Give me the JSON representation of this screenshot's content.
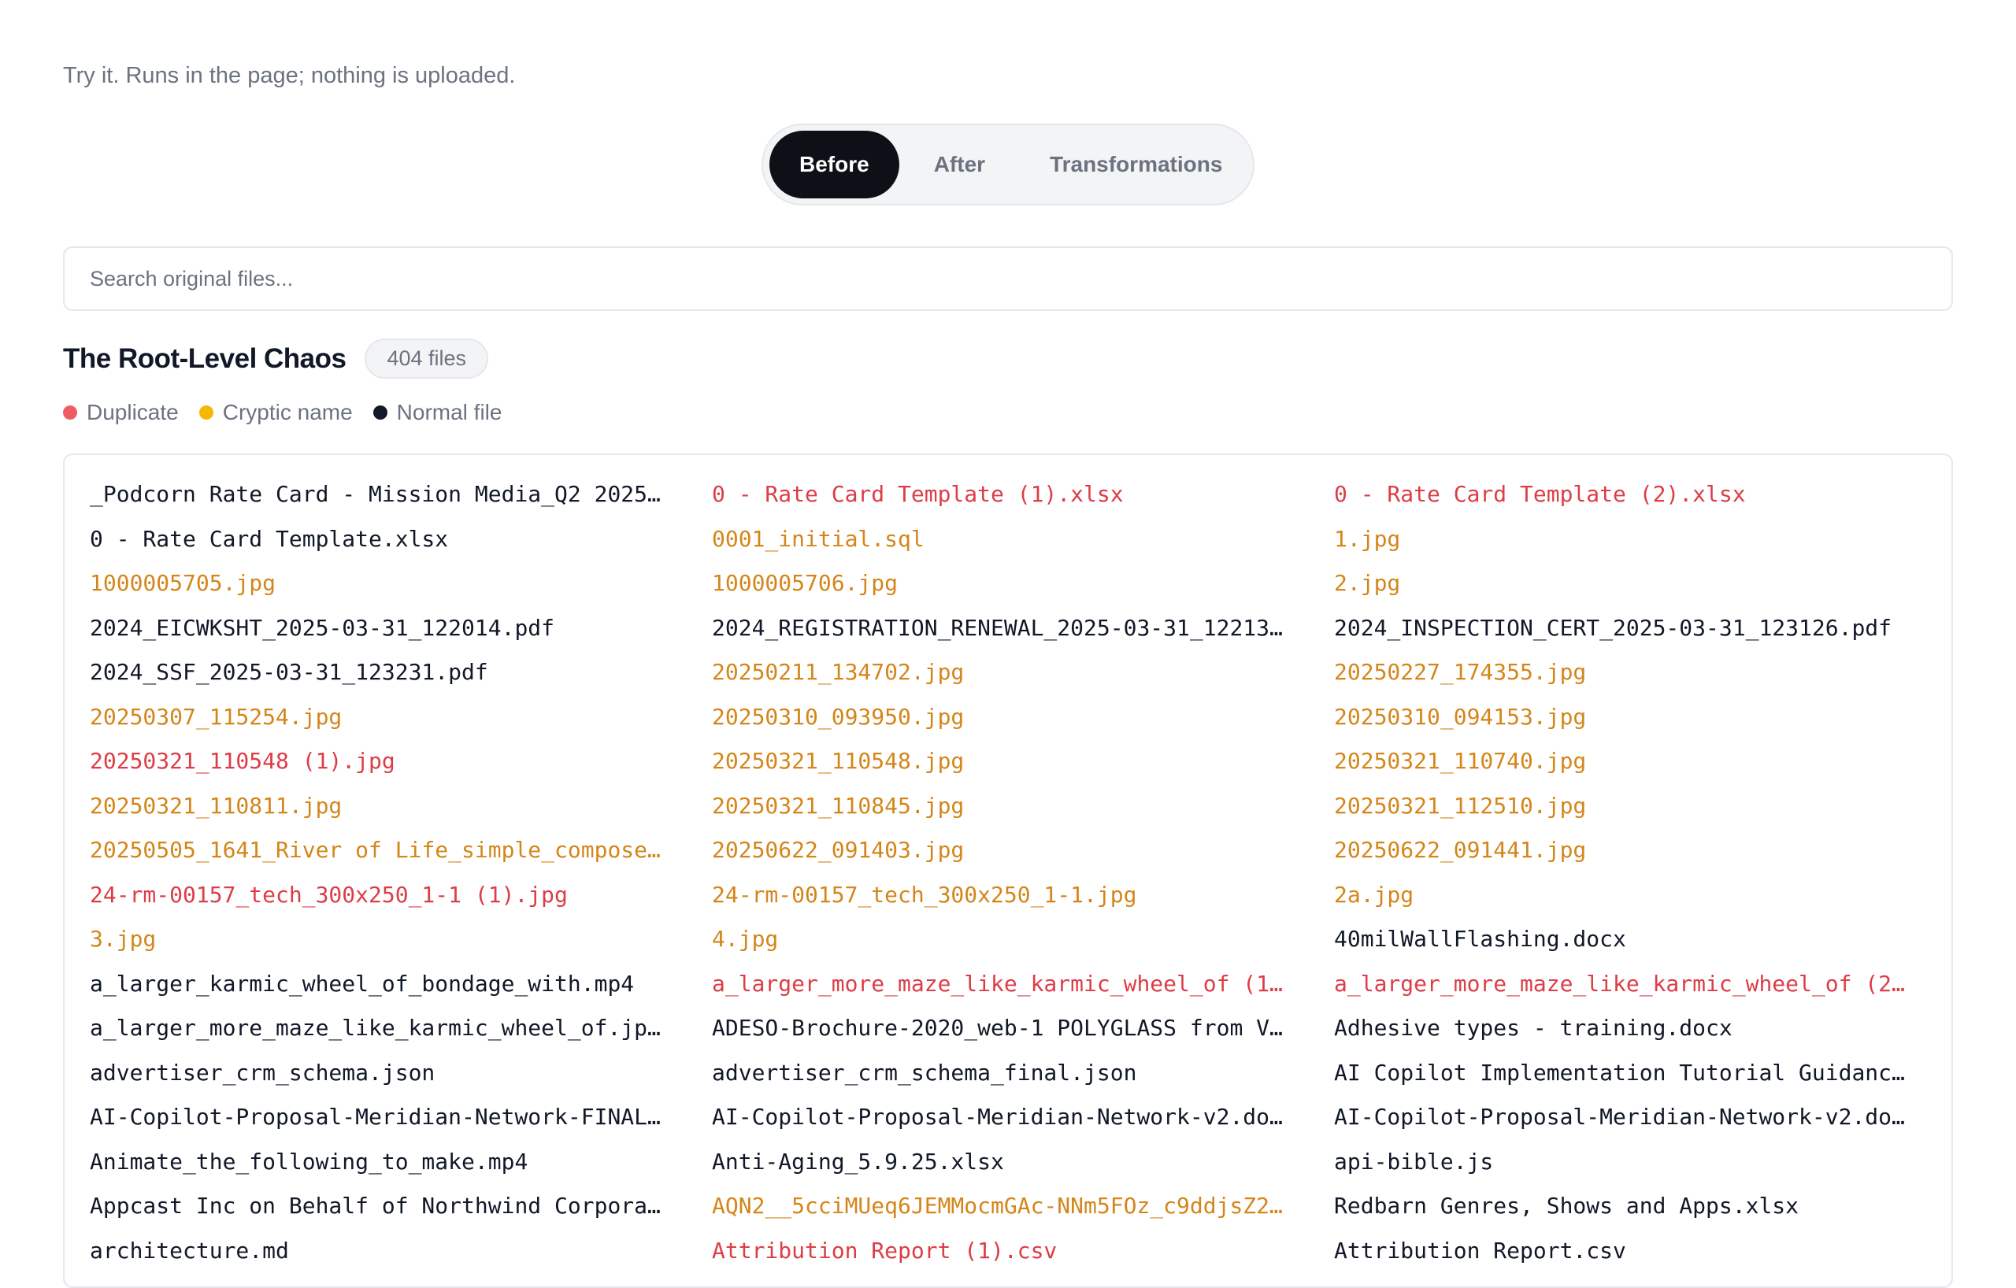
{
  "intro_text": "Try it. Runs in the page; nothing is uploaded.",
  "tabs": [
    {
      "label": "Before",
      "active": true
    },
    {
      "label": "After",
      "active": false
    },
    {
      "label": "Transformations",
      "active": false
    }
  ],
  "search": {
    "placeholder": "Search original files...",
    "value": ""
  },
  "section": {
    "title": "The Root-Level Chaos",
    "count_label": "404 files"
  },
  "legend": [
    {
      "label": "Duplicate",
      "color": "#ef5b63"
    },
    {
      "label": "Cryptic name",
      "color": "#f5b800"
    },
    {
      "label": "Normal file",
      "color": "#111827"
    }
  ],
  "colors": {
    "duplicate": "#dc3d47",
    "cryptic": "#d4861a",
    "normal": "#111827",
    "active_tab": "#0d1117"
  },
  "files": [
    {
      "name": "_Podcorn Rate Card - Mission Media_Q2 2025_…",
      "kind": "normal"
    },
    {
      "name": "0 - Rate Card Template (1).xlsx",
      "kind": "dup"
    },
    {
      "name": "0 - Rate Card Template (2).xlsx",
      "kind": "dup"
    },
    {
      "name": "0 - Rate Card Template.xlsx",
      "kind": "normal"
    },
    {
      "name": "0001_initial.sql",
      "kind": "cryptic"
    },
    {
      "name": "1.jpg",
      "kind": "cryptic"
    },
    {
      "name": "1000005705.jpg",
      "kind": "cryptic"
    },
    {
      "name": "1000005706.jpg",
      "kind": "cryptic"
    },
    {
      "name": "2.jpg",
      "kind": "cryptic"
    },
    {
      "name": "2024_EICWKSHT_2025-03-31_122014.pdf",
      "kind": "normal"
    },
    {
      "name": "2024_REGISTRATION_RENEWAL_2025-03-31_122133…",
      "kind": "normal"
    },
    {
      "name": "2024_INSPECTION_CERT_2025-03-31_123126.pdf",
      "kind": "normal"
    },
    {
      "name": "2024_SSF_2025-03-31_123231.pdf",
      "kind": "normal"
    },
    {
      "name": "20250211_134702.jpg",
      "kind": "cryptic"
    },
    {
      "name": "20250227_174355.jpg",
      "kind": "cryptic"
    },
    {
      "name": "20250307_115254.jpg",
      "kind": "cryptic"
    },
    {
      "name": "20250310_093950.jpg",
      "kind": "cryptic"
    },
    {
      "name": "20250310_094153.jpg",
      "kind": "cryptic"
    },
    {
      "name": "20250321_110548 (1).jpg",
      "kind": "dup"
    },
    {
      "name": "20250321_110548.jpg",
      "kind": "cryptic"
    },
    {
      "name": "20250321_110740.jpg",
      "kind": "cryptic"
    },
    {
      "name": "20250321_110811.jpg",
      "kind": "cryptic"
    },
    {
      "name": "20250321_110845.jpg",
      "kind": "cryptic"
    },
    {
      "name": "20250321_112510.jpg",
      "kind": "cryptic"
    },
    {
      "name": "20250505_1641_River of Life_simple_compose_…",
      "kind": "cryptic"
    },
    {
      "name": "20250622_091403.jpg",
      "kind": "cryptic"
    },
    {
      "name": "20250622_091441.jpg",
      "kind": "cryptic"
    },
    {
      "name": "24-rm-00157_tech_300x250_1-1 (1).jpg",
      "kind": "dup"
    },
    {
      "name": "24-rm-00157_tech_300x250_1-1.jpg",
      "kind": "cryptic"
    },
    {
      "name": "2a.jpg",
      "kind": "cryptic"
    },
    {
      "name": "3.jpg",
      "kind": "cryptic"
    },
    {
      "name": "4.jpg",
      "kind": "cryptic"
    },
    {
      "name": "40milWallFlashing.docx",
      "kind": "normal"
    },
    {
      "name": "a_larger_karmic_wheel_of_bondage_with.mp4",
      "kind": "normal"
    },
    {
      "name": "a_larger_more_maze_like_karmic_wheel_of (1)…",
      "kind": "dup"
    },
    {
      "name": "a_larger_more_maze_like_karmic_wheel_of (2)…",
      "kind": "dup"
    },
    {
      "name": "a_larger_more_maze_like_karmic_wheel_of.jpeg",
      "kind": "normal"
    },
    {
      "name": "ADESO-Brochure-2020_web-1 POLYGLASS from Ve…",
      "kind": "normal"
    },
    {
      "name": "Adhesive types - training.docx",
      "kind": "normal"
    },
    {
      "name": "advertiser_crm_schema.json",
      "kind": "normal"
    },
    {
      "name": "advertiser_crm_schema_final.json",
      "kind": "normal"
    },
    {
      "name": "AI Copilot Implementation Tutorial Guidance…",
      "kind": "normal"
    },
    {
      "name": "AI-Copilot-Proposal-Meridian-Network-FINAL.…",
      "kind": "normal"
    },
    {
      "name": "AI-Copilot-Proposal-Meridian-Network-v2.docx",
      "kind": "normal"
    },
    {
      "name": "AI-Copilot-Proposal-Meridian-Network-v2.doc…",
      "kind": "normal"
    },
    {
      "name": "Animate_the_following_to_make.mp4",
      "kind": "normal"
    },
    {
      "name": "Anti-Aging_5.9.25.xlsx",
      "kind": "normal"
    },
    {
      "name": "api-bible.js",
      "kind": "normal"
    },
    {
      "name": "Appcast Inc on Behalf of Northwind Corporat…",
      "kind": "normal"
    },
    {
      "name": "AQN2__5cciMUeq6JEMMocmGAc-NNm5FOz_c9ddjsZ2M…",
      "kind": "cryptic"
    },
    {
      "name": "Redbarn Genres, Shows and Apps.xlsx",
      "kind": "normal"
    },
    {
      "name": "architecture.md",
      "kind": "normal"
    },
    {
      "name": "Attribution Report (1).csv",
      "kind": "dup"
    },
    {
      "name": "Attribution Report.csv",
      "kind": "normal"
    }
  ]
}
